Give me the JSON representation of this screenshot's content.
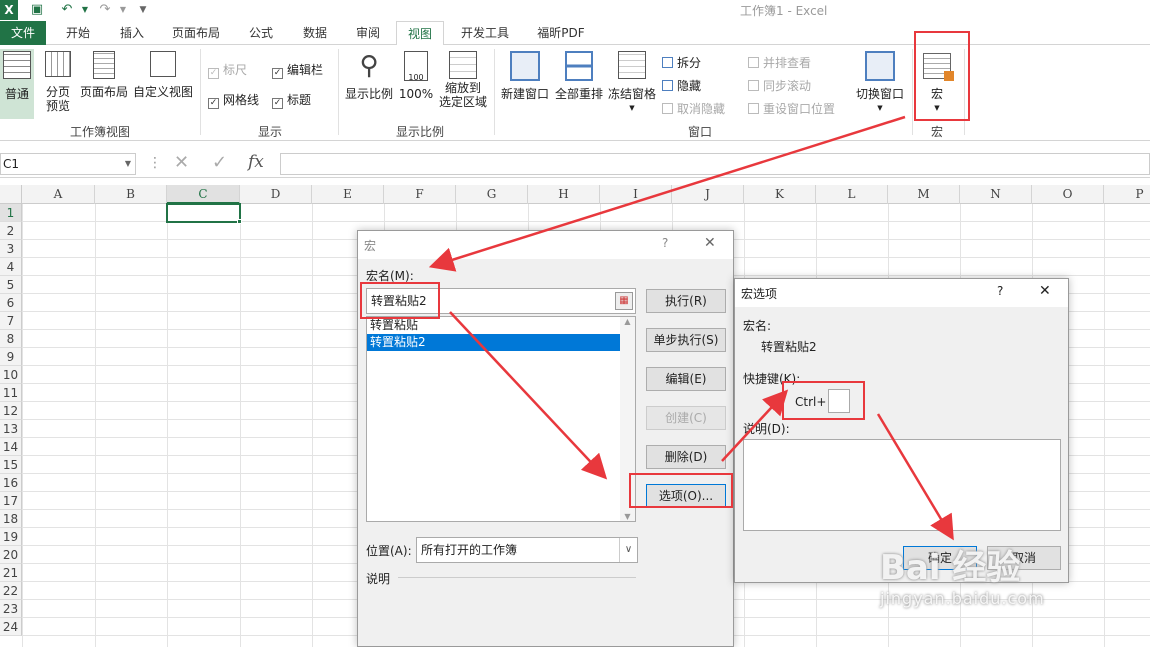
{
  "app": {
    "title": "工作簿1 - Excel",
    "logo": "X"
  },
  "quick_access": [
    "save-icon",
    "undo-icon",
    "redo-icon",
    "customize-icon"
  ],
  "tabs": [
    "文件",
    "开始",
    "插入",
    "页面布局",
    "公式",
    "数据",
    "审阅",
    "视图",
    "开发工具",
    "福昕PDF"
  ],
  "ribbon": {
    "workbook_views": {
      "normal": "普通",
      "page_break_1": "分页",
      "page_break_2": "预览",
      "page_layout": "页面布局",
      "custom_views": "自定义视图",
      "group": "工作簿视图"
    },
    "show": {
      "ruler": "标尺",
      "formula_bar": "编辑栏",
      "gridlines": "网格线",
      "headings": "标题",
      "group": "显示"
    },
    "zoom": {
      "zoom": "显示比例",
      "hundred": "100%",
      "zoom_sel_1": "缩放到",
      "zoom_sel_2": "选定区域",
      "group": "显示比例"
    },
    "window": {
      "new_window": "新建窗口",
      "arrange_all": "全部重排",
      "freeze": "冻结窗格",
      "split": "拆分",
      "hide": "隐藏",
      "unhide": "取消隐藏",
      "side_by_side": "并排查看",
      "sync_scroll": "同步滚动",
      "reset_pos": "重设窗口位置",
      "switch": "切换窗口",
      "group": "窗口"
    },
    "macros": {
      "macro": "宏",
      "group": "宏"
    }
  },
  "formula_bar": {
    "name_box": "C1",
    "fx": "fx"
  },
  "columns": [
    "A",
    "B",
    "C",
    "D",
    "E",
    "F",
    "G",
    "H",
    "I",
    "J",
    "K",
    "L",
    "M",
    "N",
    "O",
    "P"
  ],
  "rows": [
    "1",
    "2",
    "3",
    "4",
    "5",
    "6",
    "7",
    "8",
    "9",
    "10",
    "11",
    "12",
    "13",
    "14",
    "15",
    "16",
    "17",
    "18",
    "19",
    "20",
    "21",
    "22",
    "23",
    "24"
  ],
  "macro_dialog": {
    "title": "宏",
    "help": "?",
    "close": "✕",
    "name_label": "宏名(M):",
    "name_value": "转置粘贴2",
    "list": [
      "转置粘贴",
      "转置粘贴2"
    ],
    "selected_index": 1,
    "buttons": {
      "run": "执行(R)",
      "step": "单步执行(S)",
      "edit": "编辑(E)",
      "create": "创建(C)",
      "delete": "删除(D)",
      "options": "选项(O)..."
    },
    "location_label": "位置(A):",
    "location_value": "所有打开的工作簿",
    "description_label": "说明"
  },
  "options_dialog": {
    "title": "宏选项",
    "help": "?",
    "close": "✕",
    "macro_name_label": "宏名:",
    "macro_name": "转置粘贴2",
    "shortcut_label": "快捷键(K):",
    "ctrl_label": "Ctrl+",
    "shortcut_value": "",
    "description_label": "说明(D):",
    "ok": "确定",
    "cancel": "取消"
  },
  "watermark": {
    "text": "Bai 经验",
    "url": "jingyan.baidu.com"
  },
  "colors": {
    "excel_green": "#217346",
    "highlight": "#e8383d",
    "selection": "#0078d7"
  }
}
